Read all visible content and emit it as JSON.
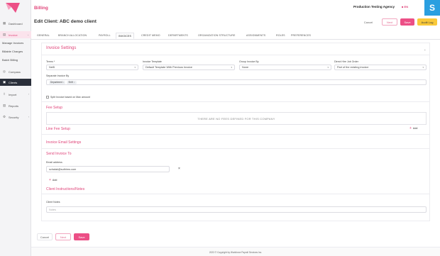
{
  "app": {
    "title": "Billing",
    "agency": "Production Testing Agency",
    "language": "EN",
    "avatar_letter": "S"
  },
  "sidebar": {
    "items": [
      {
        "label": "Dashboard",
        "icon": "dashboard-icon"
      },
      {
        "label": "Invoice",
        "icon": "invoice-icon"
      },
      {
        "label": "Manage Invoices"
      },
      {
        "label": "Billable Charges"
      },
      {
        "label": "Batch Billing"
      },
      {
        "label": "Compass",
        "icon": "compass-icon"
      },
      {
        "label": "Clients",
        "icon": "clients-icon"
      },
      {
        "label": "Import",
        "icon": "import-icon"
      },
      {
        "label": "Reports",
        "icon": "reports-icon"
      },
      {
        "label": "Security",
        "icon": "security-icon"
      }
    ]
  },
  "page": {
    "title": "Edit Client: ABC demo client",
    "buttons": {
      "cancel": "Cancel",
      "next": "Next",
      "save": "Save",
      "audit_log": "Audit Log"
    }
  },
  "tabs": [
    "GENERAL",
    "BRANCH ALLOCATION",
    "PAYROLL",
    "INVOICES",
    "CREDIT MEMO",
    "DEPARTMENTS",
    "ORGANIZATION STRUCTURE",
    "ASSIGNMENTS",
    "ROLES",
    "PREFERENCES"
  ],
  "active_tab": "INVOICES",
  "invoice_settings": {
    "title": "Invoice Settings",
    "terms": {
      "label": "Terms *",
      "value": "Net5"
    },
    "invoice_template": {
      "label": "Invoice Template",
      "value": "Default Template With Previous Invoice"
    },
    "group_invoice_by": {
      "label": "Group Invoice By",
      "value": "None"
    },
    "direct_hire": {
      "label": "Direct Hire Job Order",
      "value": "Part of the existing invoice"
    },
    "separate_invoice_by": {
      "label": "Separate Invoice By",
      "chips": [
        "Department",
        "Shift"
      ]
    },
    "split_invoice": {
      "label": "Split Invoice based on Max amount"
    }
  },
  "fee_setup": {
    "title": "Fee Setup",
    "empty": "THERE ARE NO FEES DEFINED FOR THIS COMPANY"
  },
  "line_fee_setup": {
    "title": "Line Fee Setup",
    "add": "Add"
  },
  "invoice_email": {
    "title": "Invoice Email Settings"
  },
  "send_invoice_to": {
    "title": "Send Invoice To",
    "email_label": "Email address",
    "email_value": "schalak@suthirns.com",
    "add": "Add"
  },
  "client_instructions": {
    "title": "Client Instructions/Notes",
    "label": "Client Notes",
    "placeholder": "Notes"
  },
  "bottom_buttons": {
    "cancel": "Cancel",
    "next": "Next",
    "save": "Save"
  },
  "footer": "2023 © Copyright by Workforce Payroll Services Inc.",
  "colors": {
    "accent": "#e0457a",
    "primary_button": "#ec4f86",
    "audit_button": "#f9c93a",
    "sidebar_active": "#2a2f3a",
    "avatar": "#2a9fe0"
  }
}
